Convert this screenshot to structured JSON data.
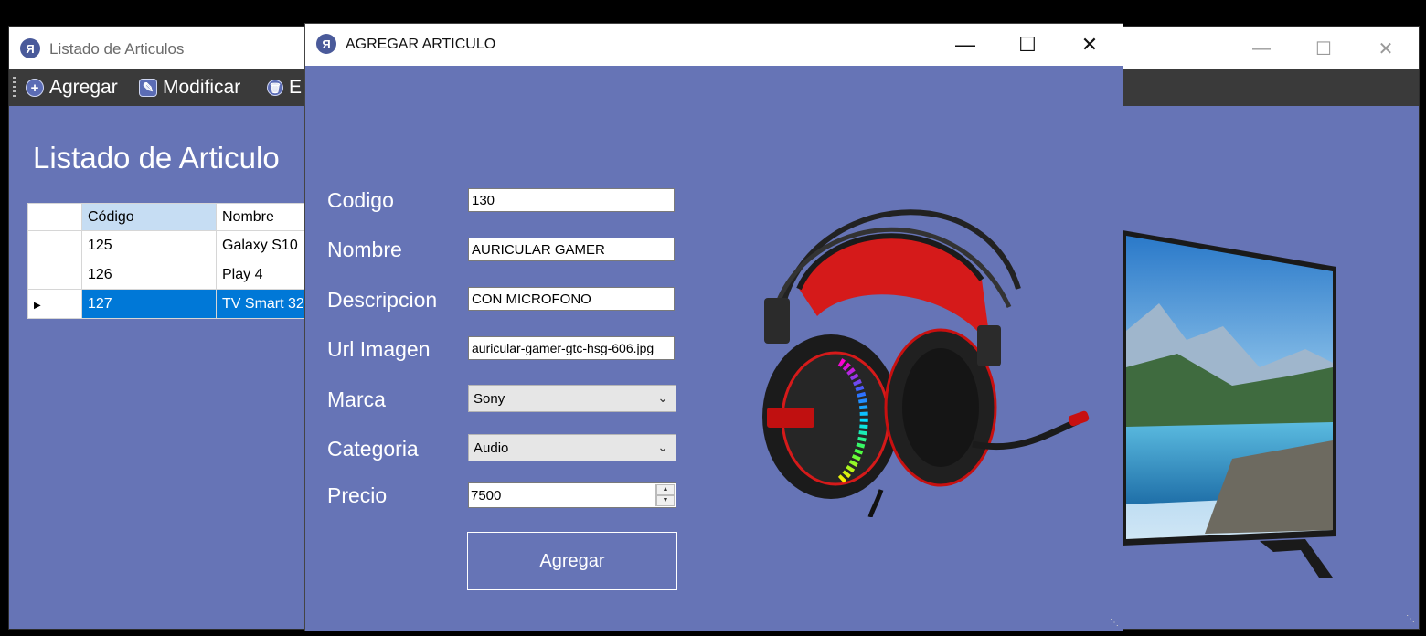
{
  "main_window": {
    "title": "Listado de Articulos",
    "toolbar": {
      "add_label": "Agregar",
      "modify_label": "Modificar",
      "delete_label": "E"
    },
    "heading": "Listado de Articulo",
    "grid": {
      "columns": [
        "Código",
        "Nombre"
      ],
      "rows": [
        {
          "codigo": "125",
          "nombre": "Galaxy S10"
        },
        {
          "codigo": "126",
          "nombre": "Play 4"
        },
        {
          "codigo": "127",
          "nombre": "TV Smart 32"
        }
      ],
      "selected_row": 2
    }
  },
  "dialog": {
    "title": "AGREGAR ARTICULO",
    "labels": {
      "codigo": "Codigo",
      "nombre": "Nombre",
      "descripcion": "Descripcion",
      "url_imagen": "Url Imagen",
      "marca": "Marca",
      "categoria": "Categoria",
      "precio": "Precio"
    },
    "values": {
      "codigo": "130",
      "nombre": "AURICULAR GAMER",
      "descripcion": "CON MICROFONO",
      "url_imagen": "auricular-gamer-gtc-hsg-606.jpg",
      "marca": "Sony",
      "categoria": "Audio",
      "precio": "7500"
    },
    "submit_label": "Agregar"
  },
  "colors": {
    "form_background": "#6674b6",
    "selection": "#0078d7",
    "toolbar": "#3a3a3a"
  },
  "icons": [
    "app-icon",
    "add-icon",
    "edit-icon",
    "delete-icon",
    "minimize-icon",
    "maximize-icon",
    "close-icon",
    "chevron-down-icon"
  ]
}
